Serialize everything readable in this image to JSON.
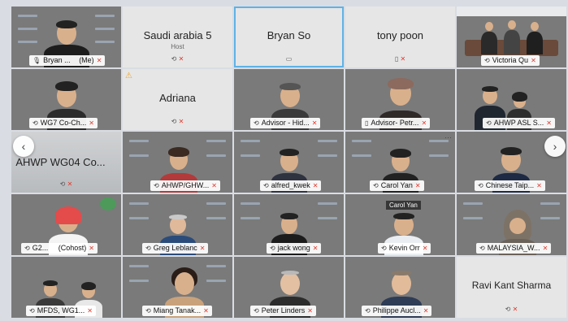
{
  "participants": [
    {
      "name": "Bryan ...",
      "suffix": "(Me)",
      "icon": "mic-icon",
      "muted": true
    },
    {
      "name": "Saudi arabia 5",
      "sub": "Host",
      "muted": true
    },
    {
      "name": "Bryan So"
    },
    {
      "name": "tony poon",
      "muted": true
    },
    {
      "name": "Victoria Qu",
      "muted": true
    },
    {
      "name": "WG7 Co-Ch...",
      "muted": true
    },
    {
      "name": "Adriana",
      "muted": true
    },
    {
      "name": "Advisor - Hid...",
      "muted": true
    },
    {
      "name": "Advisor- Petr...",
      "muted": true
    },
    {
      "name": "AHWP ASL S...",
      "muted": true
    },
    {
      "name": "AHWP WG04 Co...",
      "muted": true
    },
    {
      "name": "AHWP/GHW...",
      "muted": true
    },
    {
      "name": "alfred_kwek",
      "muted": true
    },
    {
      "name": "Carol Yan",
      "muted": true
    },
    {
      "name": "Chinese Taip...",
      "muted": true
    },
    {
      "name": "G2...",
      "suffix": "(Cohost)",
      "muted": true
    },
    {
      "name": "Greg Leblanc",
      "muted": true
    },
    {
      "name": "jack wong",
      "muted": true
    },
    {
      "name": "Kevin Orr",
      "muted": true,
      "inner_caption": "Carol Yan"
    },
    {
      "name": "MALAYSIA_W...",
      "muted": true
    },
    {
      "name": "MFDS, WG1...",
      "muted": true
    },
    {
      "name": "Miang Tanak...",
      "muted": true
    },
    {
      "name": "Peter Linders",
      "muted": true
    },
    {
      "name": "Philippe Aucl...",
      "muted": true
    },
    {
      "name": "Ravi Kant Sharma",
      "muted": true
    }
  ],
  "nav": {
    "prev": "‹",
    "next": "›"
  },
  "colors": {
    "muted": "#e23a2e",
    "active_border": "#5fb2e6"
  }
}
